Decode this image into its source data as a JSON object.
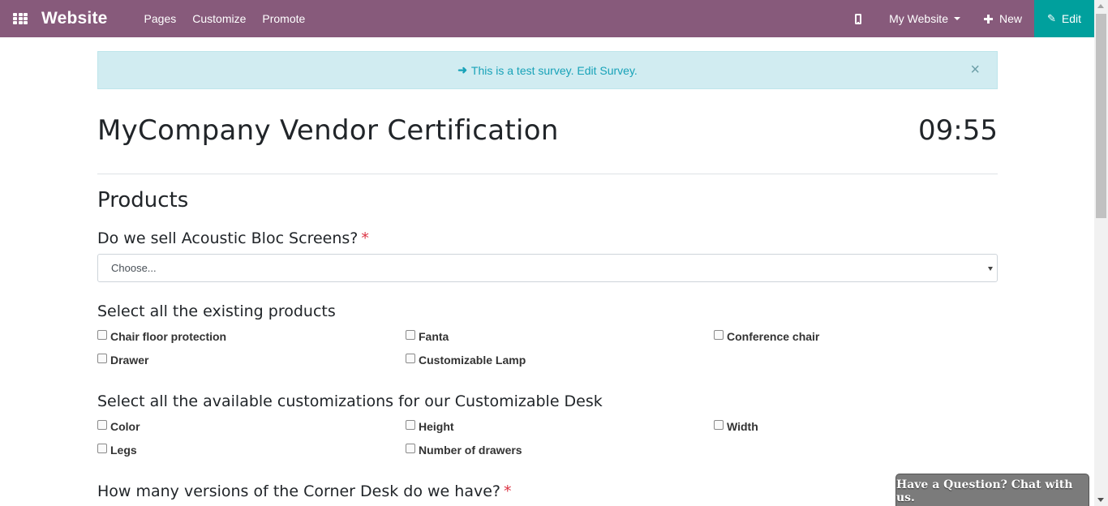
{
  "topbar": {
    "brand": "Website",
    "menu": [
      "Pages",
      "Customize",
      "Promote"
    ],
    "website_selector": "My Website",
    "new_label": "New",
    "edit_label": "Edit",
    "color": "#875a7b",
    "edit_color": "#00a09d"
  },
  "alert": {
    "text": "This is a test survey. Edit Survey.",
    "close_symbol": "×"
  },
  "survey": {
    "title": "MyCompany Vendor Certification",
    "timer": "09:55",
    "section": "Products"
  },
  "questions": [
    {
      "title": "Do we sell Acoustic Bloc Screens?",
      "required_mark": "*",
      "select_placeholder": "Choose..."
    },
    {
      "title": "Select all the existing products",
      "options": [
        "Chair floor protection",
        "Fanta",
        "Conference chair",
        "Drawer",
        "Customizable Lamp"
      ]
    },
    {
      "title": "Select all the available customizations for our Customizable Desk",
      "options": [
        "Color",
        "Height",
        "Width",
        "Legs",
        "Number of drawers"
      ]
    },
    {
      "title": "How many versions of the Corner Desk do we have?",
      "required_mark": "*"
    }
  ],
  "chat": {
    "label": "Have a Question? Chat with us."
  }
}
